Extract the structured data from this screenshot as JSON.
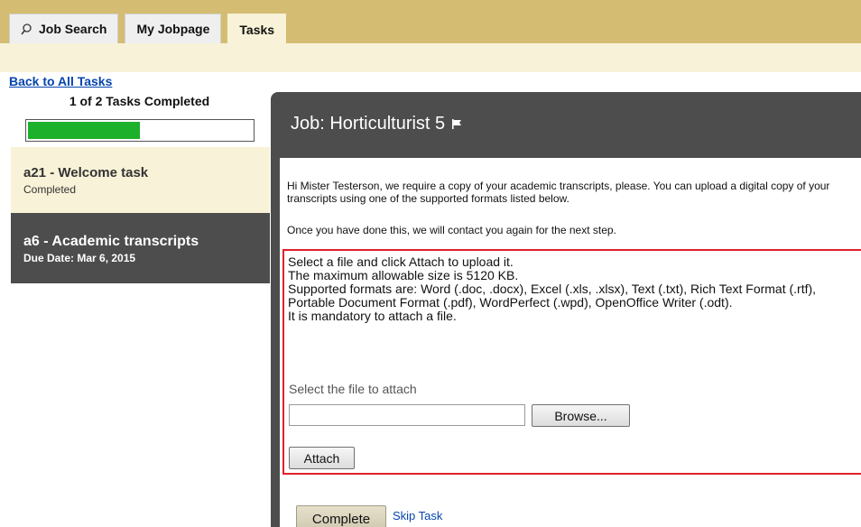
{
  "tabs": [
    {
      "label": "Job Search",
      "icon": "search-icon"
    },
    {
      "label": "My Jobpage"
    },
    {
      "label": "Tasks",
      "active": true
    }
  ],
  "sidebar": {
    "back_link": "Back to All Tasks",
    "progress_text": "1 of 2 Tasks Completed",
    "progress_fraction": 0.5,
    "progress_color": "#1db02a",
    "tasks": [
      {
        "title": "a21 - Welcome task",
        "subtitle": "Completed"
      },
      {
        "title": "a6 - Academic transcripts",
        "subtitle": "Due Date: Mar 6, 2015"
      }
    ]
  },
  "panel": {
    "title": "Job: Horticulturist 5",
    "intro": "Hi Mister Testerson, we require a copy of your academic transcripts, please. You can upload a digital copy of your transcripts using one of the supported formats listed below.",
    "intro2": "Once you have done this, we will contact you again for the next step.",
    "upload": {
      "line1": "Select a file and click Attach to upload it.",
      "line2": "The maximum allowable size is 5120 KB.",
      "line3": "Supported formats are: Word (.doc, .docx), Excel (.xls, .xlsx), Text (.txt), Rich Text Format (.rtf), Portable Document Format (.pdf), WordPerfect (.wpd), OpenOffice Writer (.odt).",
      "line4": "It is mandatory to attach a file.",
      "select_label": "Select the file to attach",
      "file_value": "",
      "browse_label": "Browse...",
      "attach_label": "Attach"
    },
    "complete_label": "Complete",
    "skip_label": "Skip Task"
  },
  "colors": {
    "topbar": "#d4bd72",
    "light": "#f8f2d8",
    "dark": "#4d4d4d",
    "border_red": "#e0202a",
    "link": "#0645ad"
  }
}
